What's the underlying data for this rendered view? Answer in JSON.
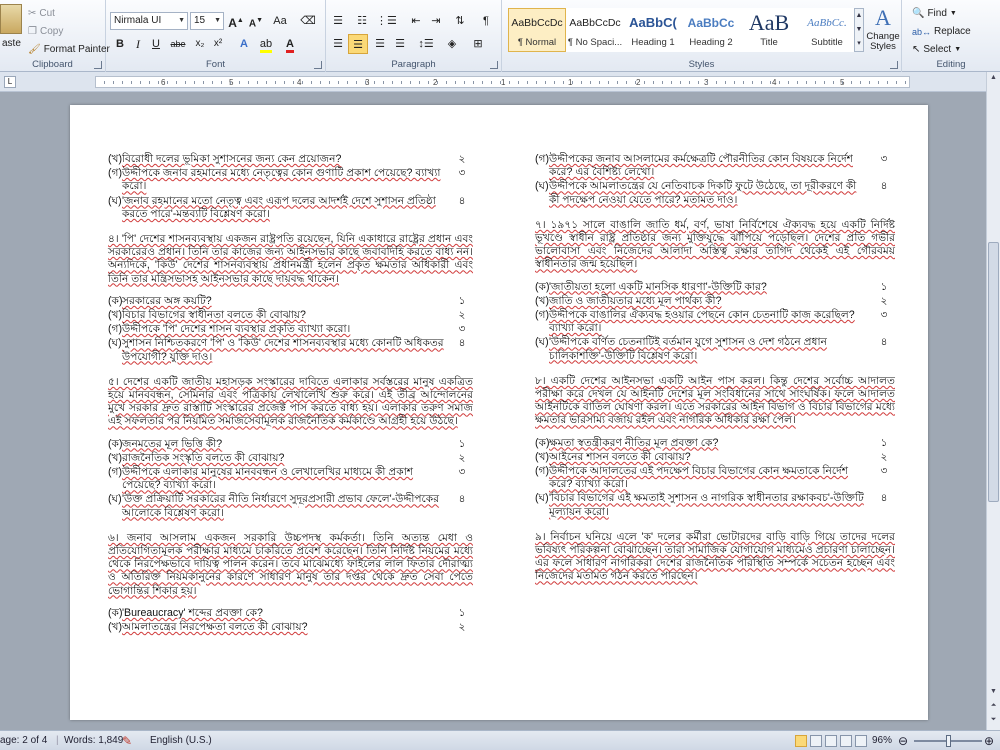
{
  "ribbon": {
    "clipboard": {
      "paste": "aste",
      "cut": "Cut",
      "copy": "Copy",
      "format_painter": "Format Painter",
      "label": "Clipboard"
    },
    "font": {
      "name": "Nirmala UI",
      "size": "15",
      "label": "Font",
      "bold": "B",
      "italic": "I",
      "underline": "U",
      "strike": "abe",
      "sub": "x₂",
      "sup": "x²",
      "grow": "A",
      "shrink": "A",
      "case": "Aa",
      "clear": "⌫"
    },
    "paragraph": {
      "label": "Paragraph",
      "pilcrow": "¶"
    },
    "styles": {
      "label": "Styles",
      "change_styles": "Change Styles",
      "items": [
        {
          "preview": "AaBbCcDc",
          "name": "¶ Normal"
        },
        {
          "preview": "AaBbCcDc",
          "name": "¶ No Spaci..."
        },
        {
          "preview": "AaBbC(",
          "name": "Heading 1"
        },
        {
          "preview": "AaBbCc",
          "name": "Heading 2"
        },
        {
          "preview": "AaB",
          "name": "Title"
        },
        {
          "preview": "AaBbCc.",
          "name": "Subtitle"
        }
      ]
    },
    "editing": {
      "label": "Editing",
      "find": "Find",
      "replace": "Replace",
      "select": "Select"
    }
  },
  "ruler": {
    "numbers": [
      "6",
      "5",
      "4",
      "3",
      "2",
      "1",
      "1",
      "2",
      "3",
      "4",
      "5"
    ]
  },
  "document": {
    "left": [
      {
        "type": "q",
        "label": "(খ)",
        "text": "বিরোধী দলের ভূমিকা সুশাসনের জন্য কেন প্রয়োজন?",
        "mark": "২"
      },
      {
        "type": "q",
        "label": "(গ)",
        "text": "উদ্দীপকে জনাব রহমানের মধ্যে নেতৃত্বের কোন গুণাটি প্রকাশ পেয়েছে? ব্যাখ্যা করো।",
        "mark": "৩"
      },
      {
        "type": "q",
        "label": "(ঘ)",
        "text": "'জনাব রহমানের মতো নেতৃত্ব এবং এরূপ দলের আদর্শই দেশে সুশাসন প্রতিষ্ঠা করতে পারে'-মন্তব্যটি বিশ্লেষণ করো।",
        "mark": "৪",
        "gap": true
      },
      {
        "type": "p",
        "text": "৪। 'পি' দেশের শাসনব্যবস্থায় একজন রাষ্ট্রপতি রয়েছেন, যিনি একাধারে রাষ্ট্রের প্রধান এবং সরকারেরও প্রধান। তিনি তার কাজের জন্য আইনসভার কাছে জবাবদিহি করতে বাধ্য নন। অন্যদিকে, 'কিউ' দেশের শাসনব্যবস্থায় প্রধানমন্ত্রী হলেন প্রকৃত ক্ষমতার অধিকারী এবং তিনি তার মন্ত্রিসভাসহ আইনসভার কাছে দায়বদ্ধ থাকেন।"
      },
      {
        "type": "q",
        "label": "(ক)",
        "text": "সরকারের অঙ্গ কয়টি?",
        "mark": "১"
      },
      {
        "type": "q",
        "label": "(খ)",
        "text": "বিচার বিভাগের স্বাধীনতা বলতে কী বোঝায়?",
        "mark": "২"
      },
      {
        "type": "q",
        "label": "(গ)",
        "text": "উদ্দীপকে 'পি' দেশের শাসন ব্যবস্থার প্রকৃতি ব্যাখ্যা করো।",
        "mark": "৩"
      },
      {
        "type": "q",
        "label": "(ঘ)",
        "text": "সুশাসন নিশ্চিতকরণে 'পি' ও 'কিউ' দেশের শাসনব্যবস্থার মধ্যে কোনটি অধিকতর উপযোগী? যুক্তি দাও।",
        "mark": "৪",
        "gap": true
      },
      {
        "type": "p",
        "text": "৫। দেশের একটি জাতীয় মহাসড়ক সংস্কারের দাবিতে এলাকার সর্বস্তরের মানুষ একত্রিত হয়ে মানববন্ধন, সেমিনার এবং পত্রিকায় লেখালেখি শুরু করে। এই তীব্র আন্দোলনের মুখে সরকার দ্রুত রাস্তাটি সংস্কারের প্রজেক্ট পাস করতে বাধ্য হয়। এলাকার তরুণ সমাজ এই সফলতার পর নিয়মিত সমাজসেবামূলক রাজনৈতিক কর্মকাণ্ডে আগ্রহী হয়ে উঠছে।"
      },
      {
        "type": "q",
        "label": "(ক)",
        "text": "জনমতের মূল ভিত্তি কী?",
        "mark": "১"
      },
      {
        "type": "q",
        "label": "(খ)",
        "text": "রাজনৈতিক সংস্কৃতি বলতে কী বোঝায়?",
        "mark": "২"
      },
      {
        "type": "q",
        "label": "(গ)",
        "text": "উদ্দীপকে এলাকার মানুষের মানববন্ধন ও লেখালেখির মাধ্যমে কী প্রকাশ পেয়েছে? ব্যাখ্যা করো।",
        "mark": "৩"
      },
      {
        "type": "q",
        "label": "(ঘ)",
        "text": "'উক্ত প্রক্রিয়াটি সরকারের নীতি নির্ধারণে সুদূরপ্রসারী প্রভাব ফেলে'-উদ্দীপকের আলোকে বিশ্লেষণ করো।",
        "mark": "৪",
        "gap": true
      },
      {
        "type": "p",
        "text": "৬। জনাব আসলাম একজন সরকারি উচ্চপদস্থ কর্মকর্তা। তিনি অত্যন্ত মেধা ও প্রতিযোগিতামূলক পরীক্ষার মাধ্যমে চাকরিতে প্রবেশ করেছেন। তিনি নির্দিষ্ট নিয়মের মধ্যে থেকে নিরপেক্ষভাবে দায়িত্ব পালন করেন। তবে মাঝেমধ্যে ফাইলের লাল ফিতার দৌরাত্ম্য ও অতিরিক্ত নিয়মকানুনের কারণে সাধারণ মানুষ তার দপ্তর থেকে দ্রুত সেবা পেতে ভোগান্তির শিকার হয়।"
      },
      {
        "type": "q",
        "label": "(ক)",
        "text": "'Bureaucracy' শব্দের প্রবক্তা কে?",
        "mark": "১"
      },
      {
        "type": "q",
        "label": "(খ)",
        "text": "আমলাতন্ত্রের নিরপেক্ষতা বলতে কী বোঝায়?",
        "mark": "২"
      }
    ],
    "right": [
      {
        "type": "q",
        "label": "(গ)",
        "text": "উদ্দীপকের জনাব আসলামের কর্মক্ষেত্রটি পৌরনীতির কোন বিষয়কে নির্দেশ করে? এর বৈশিষ্ট্য লেখো।",
        "mark": "৩"
      },
      {
        "type": "q",
        "label": "(ঘ)",
        "text": "উদ্দীপকে আমলাতন্ত্রের যে নেতিবাচক দিকটি ফুটে উঠেছে, তা দূরীকরণে কী কী পদক্ষেপ নেওয়া যেতে পারে? মতামত দাও।",
        "mark": "৪",
        "gap": true
      },
      {
        "type": "p",
        "text": "৭। ১৯৭১ সালে বাঙালি জাতি ধর্ম, বর্ণ, ভাষা নির্বিশেষে ঐক্যবদ্ধ হয়ে একটি নির্দিষ্ট ভূখণ্ডে স্বাধীন রাষ্ট্র প্রতিষ্ঠার জন্য মুক্তিযুদ্ধে ঝাঁপিয়ে পড়েছিল। দেশের প্রতি গভীর ভালোবাসা এবং নিজেদের আলাদা অস্তিত্ব রক্ষার তাগিদ থেকেই এই গৌরবময় স্বাধীনতার জন্ম হয়েছিল।"
      },
      {
        "type": "q",
        "label": "(ক)",
        "text": "'জাতীয়তা হলো একটি মানসিক ধারণা'-উক্তিটি কার?",
        "mark": "১"
      },
      {
        "type": "q",
        "label": "(খ)",
        "text": "জাতি ও জাতীয়তার মধ্যে মূল পার্থক্য কী?",
        "mark": "২"
      },
      {
        "type": "q",
        "label": "(গ)",
        "text": "উদ্দীপকে বাঙালির ঐক্যবদ্ধ হওয়ার পেছনে কোন চেতনাটি কাজ করেছিল? ব্যাখ্যা করো।",
        "mark": "৩"
      },
      {
        "type": "q",
        "label": "(ঘ)",
        "text": "'উদ্দীপকে বর্ণিত চেতনাটিই বর্তমান যুগে সুশাসন ও দেশ গঠনে প্রধান চালিকাশক্তি'-উক্তিটি বিশ্লেষণ করো।",
        "mark": "৪",
        "gap": true
      },
      {
        "type": "p",
        "text": "৮। একটি দেশের আইনসভা একটি আইন পাস করল। কিন্তু দেশের সর্বোচ্চ আদালত পরীক্ষা করে দেখল যে আইনটি দেশের মূল সংবিধানের সাথে সাংঘর্ষিক। ফলে আদালত আইনটিকে বাতিল ঘোষণা করল। এতে সরকারের আইন বিভাগ ও বিচার বিভাগের মধ্যে ক্ষমতার ভারসাম্য বজায় রইল এবং নাগরিক অধিকার রক্ষা পেল।"
      },
      {
        "type": "q",
        "label": "(ক)",
        "text": "ক্ষমতা স্বতন্ত্রীকরণ নীতির মূল প্রবক্তা কে?",
        "mark": "১"
      },
      {
        "type": "q",
        "label": "(খ)",
        "text": "আইনের শাসন বলতে কী বোঝায়?",
        "mark": "২"
      },
      {
        "type": "q",
        "label": "(গ)",
        "text": "উদ্দীপকে আদালতের এই পদক্ষেপ বিচার বিভাগের কোন ক্ষমতাকে নির্দেশ করে? ব্যাখ্যা করো।",
        "mark": "৩"
      },
      {
        "type": "q",
        "label": "(ঘ)",
        "text": "'বিচার বিভাগের এই ক্ষমতাই সুশাসন ও নাগরিক স্বাধীনতার রক্ষাকবচ'-উক্তিটি মূল্যায়ন করো।",
        "mark": "৪",
        "gap": true
      },
      {
        "type": "p",
        "text": "৯। নির্বাচন ঘনিয়ে এলে 'ক' দলের কর্মীরা ভোটারদের বাড়ি বাড়ি গিয়ে তাদের দলের ভবিষ্যৎ পরিকল্পনা বোঝাচ্ছেন। তারা সামাজিক যোগাযোগ মাধ্যমেও প্রচারণা চালাচ্ছেন। এর ফলে সাধারণ নাগরিকরা দেশের রাজনৈতিক পরিস্থিতি সম্পর্কে সচেতন হচ্ছেন এবং নিজেদের মতামত গঠন করতে পারছেন।"
      }
    ]
  },
  "status": {
    "page": "age: 2 of 4",
    "words": "Words: 1,849",
    "language": "English (U.S.)",
    "zoom": "96%"
  }
}
